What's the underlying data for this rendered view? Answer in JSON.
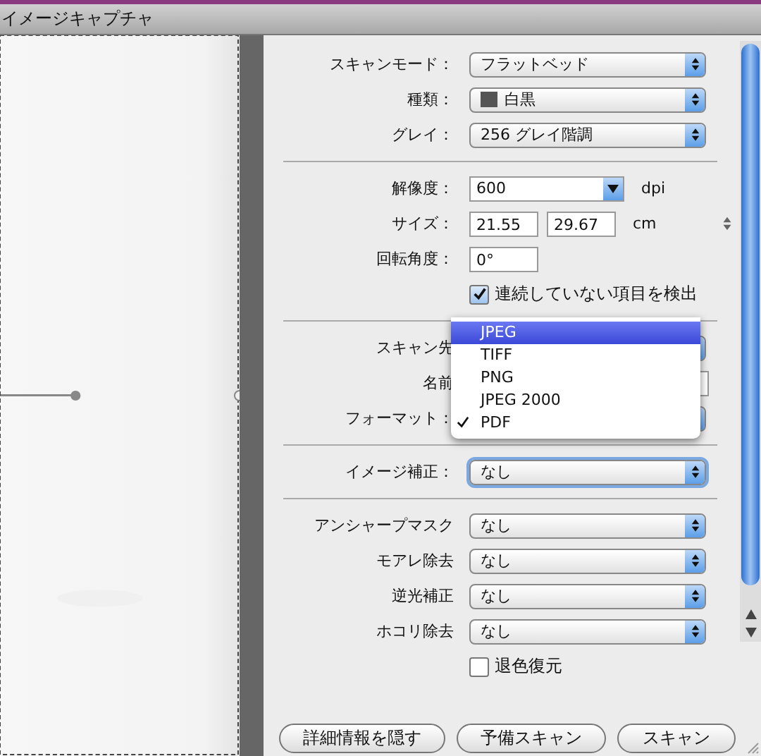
{
  "window": {
    "title": "イメージキャプチャ"
  },
  "sections": [
    {
      "rows": [
        {
          "kind": "popup",
          "label": "スキャンモード：",
          "value": "フラットベッド"
        },
        {
          "kind": "popup",
          "label": "種類：",
          "value": "白黒",
          "thumb": true
        },
        {
          "kind": "popup",
          "label": "グレイ：",
          "value": "256 グレイ階調"
        }
      ]
    },
    {
      "rows": [
        {
          "kind": "combo",
          "label": "解像度：",
          "value": "600",
          "unit": "dpi"
        },
        {
          "kind": "size",
          "label": "サイズ：",
          "value": "21.55",
          "value2": "29.67",
          "unit": "cm"
        },
        {
          "kind": "text",
          "label": "回転角度：",
          "value": "0°"
        },
        {
          "kind": "checkbox",
          "label": "連続していない項目を検出",
          "checked": true
        }
      ]
    },
    {
      "rows": [
        {
          "kind": "popup",
          "label": "スキャン先"
        },
        {
          "kind": "text",
          "label": "名前"
        },
        {
          "kind": "popup",
          "label": "フォーマット："
        }
      ]
    },
    {
      "rows": [
        {
          "kind": "popup",
          "label": "イメージ補正：",
          "value": "なし",
          "focused": true
        }
      ]
    },
    {
      "rows": [
        {
          "kind": "popup",
          "label": "アンシャープマスク",
          "value": "なし"
        },
        {
          "kind": "popup",
          "label": "モアレ除去",
          "value": "なし"
        },
        {
          "kind": "popup",
          "label": "逆光補正",
          "value": "なし"
        },
        {
          "kind": "popup",
          "label": "ホコリ除去",
          "value": "なし"
        },
        {
          "kind": "checkbox",
          "label": "退色復元",
          "checked": false
        }
      ]
    }
  ],
  "format_menu": [
    {
      "label": "JPEG",
      "selected": true,
      "checked": false
    },
    {
      "label": "TIFF",
      "selected": false,
      "checked": false
    },
    {
      "label": "PNG",
      "selected": false,
      "checked": false
    },
    {
      "label": "JPEG 2000",
      "selected": false,
      "checked": false
    },
    {
      "label": "PDF",
      "selected": false,
      "checked": true
    }
  ],
  "buttons": [
    "詳細情報を隠す",
    "予備スキャン",
    "スキャン"
  ]
}
